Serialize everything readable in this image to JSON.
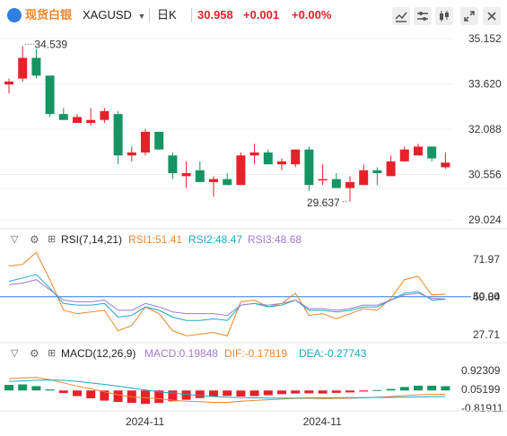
{
  "toolbar": {
    "brand": "现货白银",
    "symbol": "XAGUSD",
    "period": "日K",
    "price": "30.958",
    "change": "+0.001",
    "change_pct": "+0.00%",
    "colors": {
      "brand": "#f0862b",
      "up": "#e8202a",
      "down": "#159464"
    }
  },
  "chart_data": [
    {
      "type": "candlestick",
      "title": "XAGUSD",
      "y_ticks": [
        "35.152",
        "33.620",
        "32.088",
        "30.556",
        "29.024"
      ],
      "ylim": [
        29.024,
        35.152
      ],
      "x_ticks": [
        "2024-11",
        "2024-11"
      ],
      "annotations": {
        "high": "34.539",
        "low": "29.637"
      },
      "ohlc": [
        [
          33.6,
          33.8,
          33.3,
          33.7
        ],
        [
          33.8,
          34.9,
          33.7,
          34.5
        ],
        [
          34.5,
          34.8,
          33.8,
          33.9
        ],
        [
          33.9,
          33.9,
          32.5,
          32.6
        ],
        [
          32.6,
          32.8,
          32.4,
          32.4
        ],
        [
          32.3,
          32.6,
          32.3,
          32.5
        ],
        [
          32.3,
          32.8,
          32.2,
          32.4
        ],
        [
          32.4,
          32.8,
          32.3,
          32.7
        ],
        [
          32.6,
          32.7,
          30.9,
          31.2
        ],
        [
          31.2,
          31.5,
          31.0,
          31.3
        ],
        [
          31.3,
          32.1,
          31.2,
          32.0
        ],
        [
          32.0,
          32.0,
          31.4,
          31.4
        ],
        [
          31.2,
          31.3,
          30.4,
          30.6
        ],
        [
          30.5,
          31.0,
          30.1,
          30.6
        ],
        [
          30.7,
          31.0,
          30.3,
          30.3
        ],
        [
          30.3,
          30.5,
          29.8,
          30.4
        ],
        [
          30.4,
          30.6,
          30.2,
          30.2
        ],
        [
          30.2,
          31.3,
          30.2,
          31.2
        ],
        [
          31.2,
          31.6,
          30.9,
          31.3
        ],
        [
          31.3,
          31.4,
          30.9,
          30.9
        ],
        [
          30.9,
          31.1,
          30.7,
          31.0
        ],
        [
          30.9,
          31.4,
          30.8,
          31.4
        ],
        [
          31.4,
          31.5,
          30.0,
          30.2
        ],
        [
          30.4,
          30.9,
          30.2,
          30.4
        ],
        [
          30.4,
          30.6,
          30.1,
          30.1
        ],
        [
          30.1,
          30.5,
          29.637,
          30.3
        ],
        [
          30.2,
          30.9,
          30.2,
          30.7
        ],
        [
          30.7,
          30.8,
          30.2,
          30.6
        ],
        [
          30.5,
          31.2,
          30.5,
          31.0
        ],
        [
          31.0,
          31.5,
          31.0,
          31.4
        ],
        [
          31.2,
          31.6,
          31.2,
          31.5
        ],
        [
          31.5,
          31.5,
          31.0,
          31.1
        ],
        [
          30.8,
          31.3,
          30.75,
          30.958
        ]
      ]
    },
    {
      "type": "line",
      "title": "RSI(7,14,21)",
      "y_ticks": [
        "71.97",
        "49.84",
        "27.71"
      ],
      "ylim": [
        27.71,
        71.97
      ],
      "reference_line": "50.00",
      "series": [
        {
          "name": "RSI1:51.41",
          "color": "#f0862b",
          "values": [
            68,
            69,
            76,
            60,
            42,
            40,
            41,
            42,
            30,
            33,
            44,
            40,
            30,
            27,
            28,
            29,
            27,
            47,
            48,
            44,
            46,
            52,
            39,
            40,
            37,
            40,
            43,
            42,
            49,
            60,
            62,
            51,
            51.41
          ]
        },
        {
          "name": "RSI2:48.47",
          "color": "#1ba9c1",
          "values": [
            59,
            61,
            63,
            55,
            46,
            45,
            45,
            46,
            38,
            39,
            44,
            42,
            38,
            36,
            36,
            37,
            36,
            45,
            46,
            44,
            45,
            48,
            42,
            42,
            41,
            42,
            44,
            44,
            48,
            52,
            53,
            48,
            48.47
          ]
        },
        {
          "name": "RSI3:48.68",
          "color": "#a17ad0",
          "values": [
            57,
            58,
            60,
            54,
            48,
            47,
            47,
            48,
            42,
            42,
            46,
            44,
            41,
            40,
            40,
            40,
            39,
            45,
            46,
            45,
            46,
            48,
            43,
            43,
            42,
            43,
            45,
            45,
            48,
            51,
            52,
            49,
            48.68
          ]
        }
      ]
    },
    {
      "type": "bar+line",
      "title": "MACD(12,26,9)",
      "y_ticks": [
        "0.92309",
        "0.05199",
        "-0.81911"
      ],
      "ylim": [
        -0.81911,
        0.92309
      ],
      "x_ticks": [
        "2024-11",
        "2024-11"
      ],
      "histogram": {
        "name": "MACD:0.19848",
        "values": [
          0.26,
          0.28,
          0.2,
          0.05,
          -0.12,
          -0.26,
          -0.36,
          -0.47,
          -0.53,
          -0.57,
          -0.62,
          -0.58,
          -0.5,
          -0.43,
          -0.35,
          -0.28,
          -0.25,
          -0.28,
          -0.26,
          -0.22,
          -0.17,
          -0.14,
          -0.13,
          -0.14,
          -0.11,
          -0.09,
          -0.05,
          0.02,
          0.07,
          0.16,
          0.22,
          0.22,
          0.19848
        ]
      },
      "series": [
        {
          "name": "DIF:-0.17819",
          "color": "#f0862b",
          "values": [
            0.55,
            0.58,
            0.6,
            0.5,
            0.35,
            0.2,
            0.08,
            -0.06,
            -0.2,
            -0.3,
            -0.33,
            -0.38,
            -0.45,
            -0.5,
            -0.52,
            -0.55,
            -0.55,
            -0.5,
            -0.46,
            -0.43,
            -0.4,
            -0.37,
            -0.36,
            -0.38,
            -0.37,
            -0.36,
            -0.34,
            -0.31,
            -0.28,
            -0.24,
            -0.2,
            -0.18,
            -0.17819
          ]
        },
        {
          "name": "DEA:-0.27743",
          "color": "#1ba9c1",
          "values": [
            0.42,
            0.44,
            0.47,
            0.48,
            0.47,
            0.42,
            0.35,
            0.28,
            0.2,
            0.11,
            0.02,
            -0.06,
            -0.12,
            -0.18,
            -0.24,
            -0.28,
            -0.31,
            -0.33,
            -0.34,
            -0.35,
            -0.35,
            -0.35,
            -0.34,
            -0.34,
            -0.33,
            -0.33,
            -0.33,
            -0.32,
            -0.32,
            -0.31,
            -0.3,
            -0.29,
            -0.27743
          ]
        }
      ]
    }
  ],
  "icon_names": [
    "brand-logo-icon",
    "dropdown-icon",
    "draw-line-icon",
    "indicator-icon",
    "candle-style-icon",
    "drawing-icon",
    "fullscreen-icon",
    "close-icon",
    "collapse-icon",
    "settings-icon",
    "add-indicator-icon"
  ]
}
